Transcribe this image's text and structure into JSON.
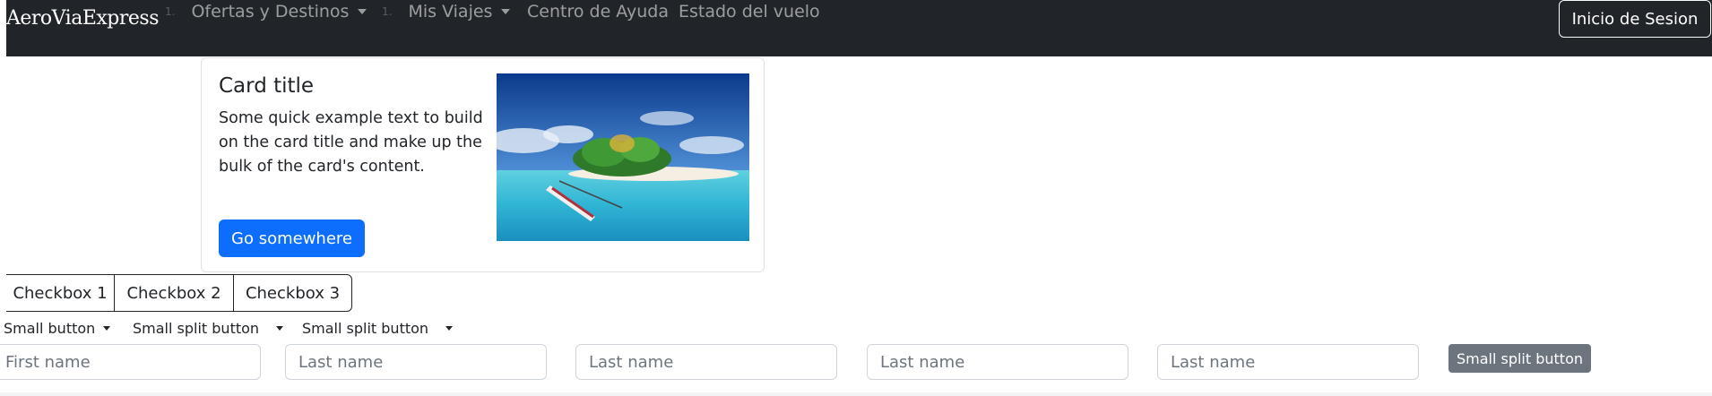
{
  "navbar": {
    "brand": "AeroViaExpress",
    "items": [
      {
        "num": "1.",
        "label": "Ofertas y Destinos"
      },
      {
        "num": "1.",
        "label": "Mis Viajes"
      },
      {
        "label": "Centro de Ayuda"
      },
      {
        "label": "Estado del vuelo"
      }
    ],
    "login_label": "Inicio de Sesion"
  },
  "card": {
    "title": "Card title",
    "text": "Some quick example text to build on the card title and make up the bulk of the card's content.",
    "button_label": "Go somewhere"
  },
  "checkboxes": [
    "Checkbox 1",
    "Checkbox 2",
    "Checkbox 3"
  ],
  "small_buttons": [
    "Small button",
    "Small split button",
    "Small split button"
  ],
  "inputs": [
    {
      "placeholder": "First name"
    },
    {
      "placeholder": "Last name"
    },
    {
      "placeholder": "Last name"
    },
    {
      "placeholder": "Last name"
    },
    {
      "placeholder": "Last name"
    }
  ],
  "grey_button_label": "Small split button",
  "colors": {
    "navbar_bg": "#212529",
    "primary": "#0d6efd",
    "secondary": "#6c757d"
  }
}
